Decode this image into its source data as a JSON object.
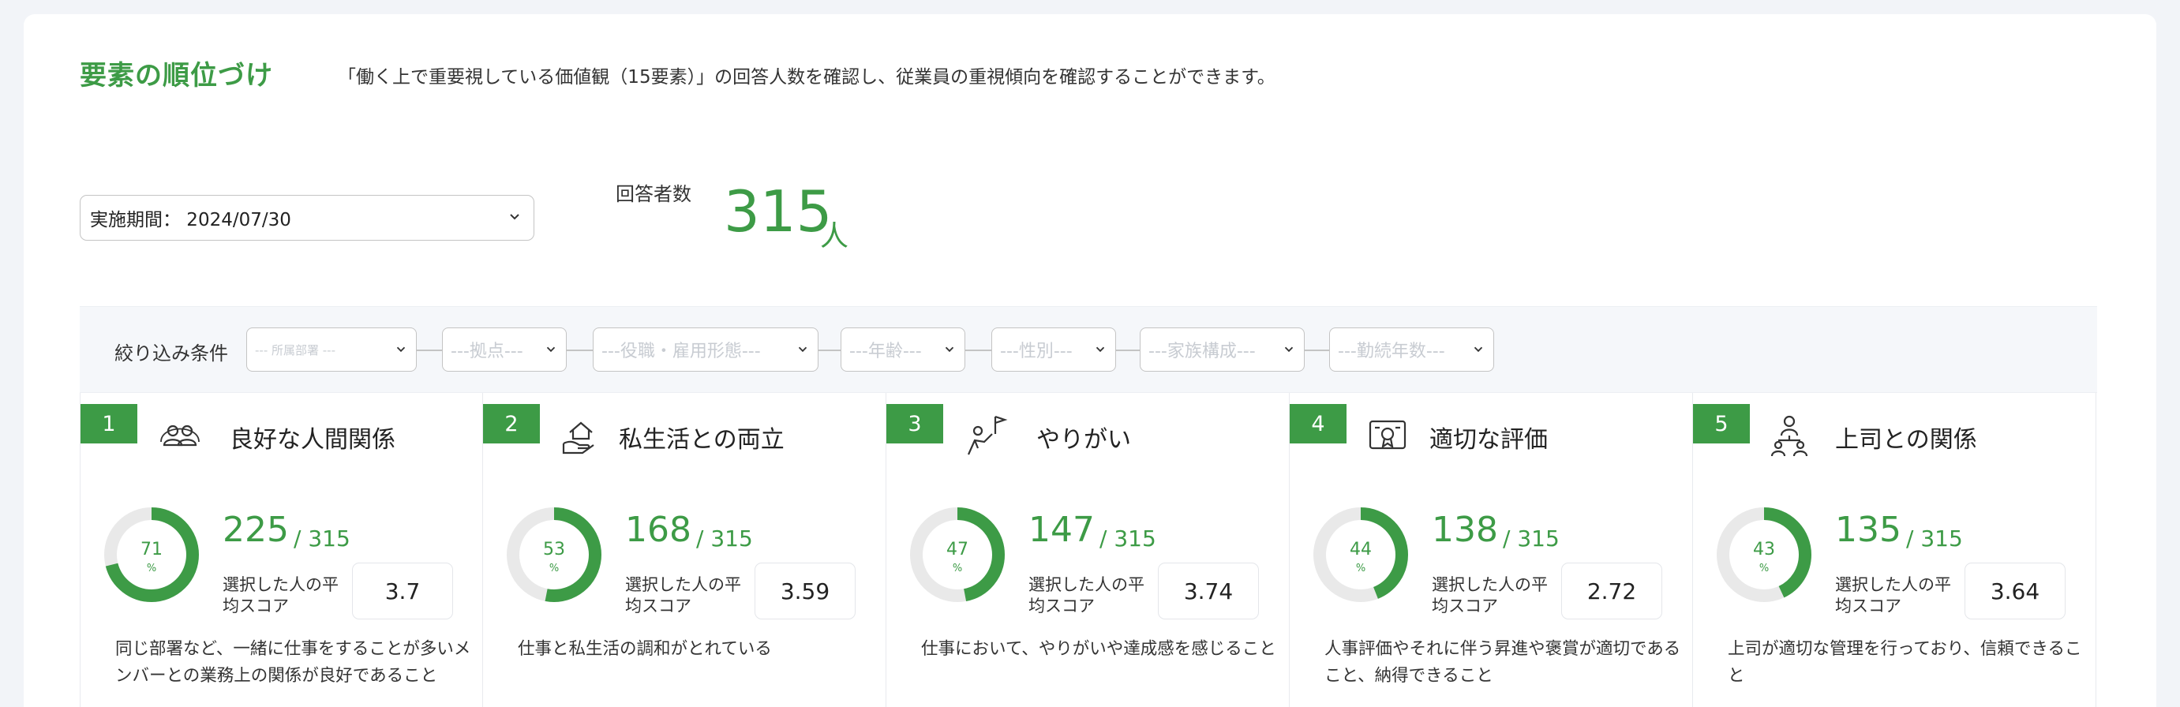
{
  "header": {
    "title": "要素の順位づけ",
    "subtitle": "「働く上で重要視している価値観（15要素）」の回答人数を確認し、従業員の重視傾向を確認することができます。"
  },
  "period": {
    "value": "実施期間： 2024/07/30"
  },
  "respondents": {
    "label": "回答者数",
    "count": "315",
    "unit": "人"
  },
  "filters": {
    "label": "絞り込み条件",
    "options": [
      {
        "placeholder": "--- 所属部署 ---"
      },
      {
        "placeholder": "---拠点---"
      },
      {
        "placeholder": "---役職・雇用形態---"
      },
      {
        "placeholder": "---年齢---"
      },
      {
        "placeholder": "---性別---"
      },
      {
        "placeholder": "---家族構成---"
      },
      {
        "placeholder": "---勤続年数---"
      }
    ]
  },
  "cards": [
    {
      "rank": "1",
      "icon": "people-icon",
      "name": "良好な人間関係",
      "percent": 71,
      "percent_unit": "%",
      "count": "225",
      "total": "/ 315",
      "score_label": "選択した人の平均スコア",
      "score": "3.7",
      "description": "同じ部署など、一緒に仕事をすることが多いメンバーとの業務上の関係が良好であること"
    },
    {
      "rank": "2",
      "icon": "home-hand-icon",
      "name": "私生活との両立",
      "percent": 53,
      "percent_unit": "%",
      "count": "168",
      "total": "/ 315",
      "score_label": "選択した人の平均スコア",
      "score": "3.59",
      "description": "仕事と私生活の調和がとれている"
    },
    {
      "rank": "3",
      "icon": "flag-person-icon",
      "name": "やりがい",
      "percent": 47,
      "percent_unit": "%",
      "count": "147",
      "total": "/ 315",
      "score_label": "選択した人の平均スコア",
      "score": "3.74",
      "description": "仕事において、やりがいや達成感を感じること"
    },
    {
      "rank": "4",
      "icon": "certificate-icon",
      "name": "適切な評価",
      "percent": 44,
      "percent_unit": "%",
      "count": "138",
      "total": "/ 315",
      "score_label": "選択した人の平均スコア",
      "score": "2.72",
      "description": "人事評価やそれに伴う昇進や褒賞が適切であること、納得できること"
    },
    {
      "rank": "5",
      "icon": "org-chart-icon",
      "name": "上司との関係",
      "percent": 43,
      "percent_unit": "%",
      "count": "135",
      "total": "/ 315",
      "score_label": "選択した人の平均スコア",
      "score": "3.64",
      "description": "上司が適切な管理を行っており、信頼できること"
    }
  ],
  "colors": {
    "accent": "#3d9b46",
    "ring_track": "#e9e9e9"
  }
}
